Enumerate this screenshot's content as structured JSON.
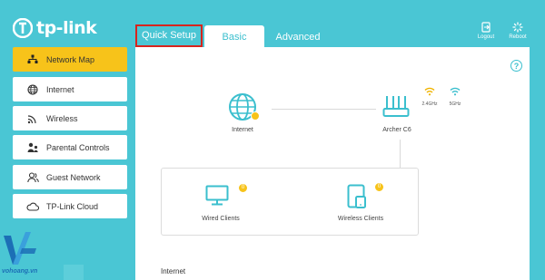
{
  "brand": {
    "logo_text": "tp-link"
  },
  "header": {
    "tabs": [
      {
        "label": "Quick Setup",
        "state": "highlighted"
      },
      {
        "label": "Basic",
        "state": "active"
      },
      {
        "label": "Advanced",
        "state": "normal"
      }
    ],
    "actions": [
      {
        "label": "Logout",
        "icon": "logout-icon"
      },
      {
        "label": "Reboot",
        "icon": "reboot-icon"
      }
    ]
  },
  "sidebar": {
    "items": [
      {
        "label": "Network Map",
        "icon": "network-map-icon",
        "active": true
      },
      {
        "label": "Internet",
        "icon": "globe-icon",
        "active": false
      },
      {
        "label": "Wireless",
        "icon": "wireless-icon",
        "active": false
      },
      {
        "label": "Parental Controls",
        "icon": "parental-controls-icon",
        "active": false
      },
      {
        "label": "Guest Network",
        "icon": "guest-network-icon",
        "active": false
      },
      {
        "label": "TP-Link Cloud",
        "icon": "cloud-icon",
        "active": false
      }
    ]
  },
  "network_map": {
    "internet_label": "Internet",
    "router_label": "Archer C6",
    "band_24": "2.4GHz",
    "band_5": "5GHz",
    "wired_clients_label": "Wired Clients",
    "wired_clients_count": "0",
    "wireless_clients_label": "Wireless Clients",
    "wireless_clients_count": "0"
  },
  "section": {
    "title": "Internet"
  },
  "watermark": {
    "text": "vohoang.vn"
  },
  "colors": {
    "background": "#4ac6d4",
    "accent": "#3bbfce",
    "active_item": "#f7c31a",
    "highlight_border": "#d7241d",
    "watermark": "#1c6fb6"
  }
}
